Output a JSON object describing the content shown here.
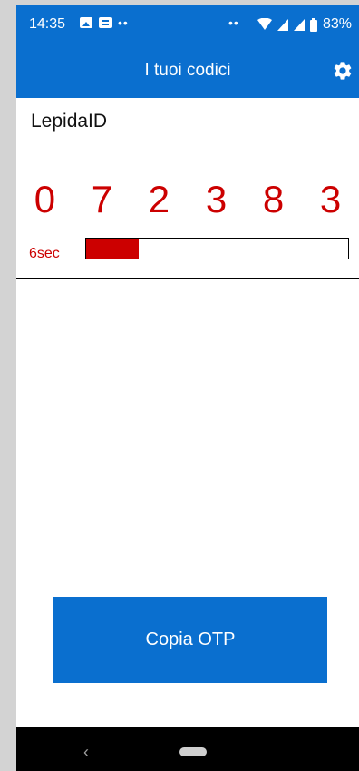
{
  "status_bar": {
    "time": "14:35",
    "battery": "83%",
    "icons": [
      "image-icon",
      "message-icon",
      "more-dots-icon",
      "wifi-icon",
      "signal-icon",
      "signal-icon",
      "battery-icon"
    ]
  },
  "app_bar": {
    "title": "I tuoi codici",
    "settings_icon": "gear-icon",
    "color": "#0a6fcf"
  },
  "account": {
    "name": "LepidaID",
    "otp_code": "0 7 2 3 8 3",
    "otp_color": "#cc0000",
    "timer_label": "6sec",
    "time_remaining_fraction": 0.2
  },
  "actions": {
    "copy_label": "Copia OTP"
  },
  "nav_bar": {
    "back_icon": "back-chevron-icon",
    "home_icon": "home-pill-icon"
  }
}
